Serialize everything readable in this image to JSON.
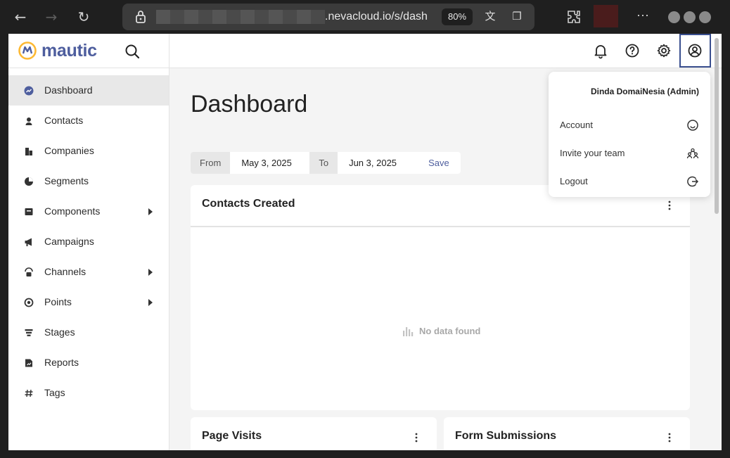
{
  "browser": {
    "url_visible": ".nevacloud.io/s/dash",
    "zoom": "80%"
  },
  "app": {
    "logo_text": "mautic",
    "brand_color": "#4e5e9e",
    "accent_color": "#fdb933"
  },
  "sidebar": {
    "items": [
      {
        "label": "Dashboard",
        "icon": "dashboard-icon",
        "active": true,
        "has_submenu": false
      },
      {
        "label": "Contacts",
        "icon": "person-icon",
        "active": false,
        "has_submenu": false
      },
      {
        "label": "Companies",
        "icon": "building-icon",
        "active": false,
        "has_submenu": false
      },
      {
        "label": "Segments",
        "icon": "pie-icon",
        "active": false,
        "has_submenu": false
      },
      {
        "label": "Components",
        "icon": "box-icon",
        "active": false,
        "has_submenu": true
      },
      {
        "label": "Campaigns",
        "icon": "megaphone-icon",
        "active": false,
        "has_submenu": false
      },
      {
        "label": "Channels",
        "icon": "broadcast-icon",
        "active": false,
        "has_submenu": true
      },
      {
        "label": "Points",
        "icon": "target-icon",
        "active": false,
        "has_submenu": true
      },
      {
        "label": "Stages",
        "icon": "funnel-icon",
        "active": false,
        "has_submenu": false
      },
      {
        "label": "Reports",
        "icon": "report-icon",
        "active": false,
        "has_submenu": false
      },
      {
        "label": "Tags",
        "icon": "hash-icon",
        "active": false,
        "has_submenu": false
      }
    ]
  },
  "main": {
    "title": "Dashboard",
    "date_filter": {
      "from_label": "From",
      "from_value": "May 3, 2025",
      "to_label": "To",
      "to_value": "Jun 3, 2025",
      "save_label": "Save"
    },
    "widgets": [
      {
        "title": "Contacts Created",
        "empty_text": "No data found"
      },
      {
        "title": "Page Visits"
      },
      {
        "title": "Form Submissions"
      }
    ]
  },
  "user_menu": {
    "username": "Dinda DomaiNesia (Admin)",
    "items": [
      {
        "label": "Account",
        "icon": "smiley-icon"
      },
      {
        "label": "Invite your team",
        "icon": "team-icon"
      },
      {
        "label": "Logout",
        "icon": "logout-icon"
      }
    ]
  }
}
